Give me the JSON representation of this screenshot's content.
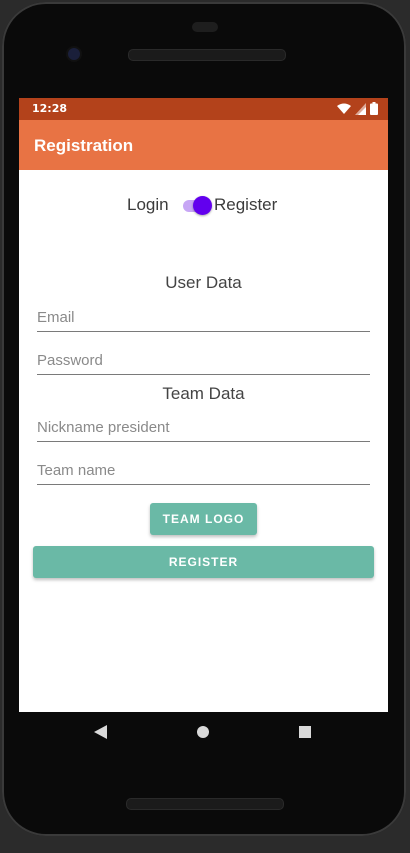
{
  "status_bar": {
    "time": "12:28",
    "icons": [
      "wifi-icon",
      "signal-icon",
      "battery-icon"
    ],
    "color": "#b3421b"
  },
  "app_bar": {
    "title": "Registration",
    "color": "#e87344"
  },
  "mode_toggle": {
    "left_label": "Login",
    "right_label": "Register",
    "checked": true,
    "accent": "#6200ee"
  },
  "user_section": {
    "heading": "User Data",
    "email": {
      "placeholder": "Email",
      "value": ""
    },
    "password": {
      "placeholder": "Password",
      "value": ""
    }
  },
  "team_section": {
    "heading": "Team Data",
    "nickname": {
      "placeholder": "Nickname president",
      "value": ""
    },
    "team_name": {
      "placeholder": "Team name",
      "value": ""
    }
  },
  "buttons": {
    "team_logo_label": "TEAM LOGO",
    "register_label": "REGISTER",
    "color": "#6ab9a6"
  },
  "nav_bar": {
    "icons": [
      "back-icon",
      "home-icon",
      "overview-icon"
    ]
  }
}
